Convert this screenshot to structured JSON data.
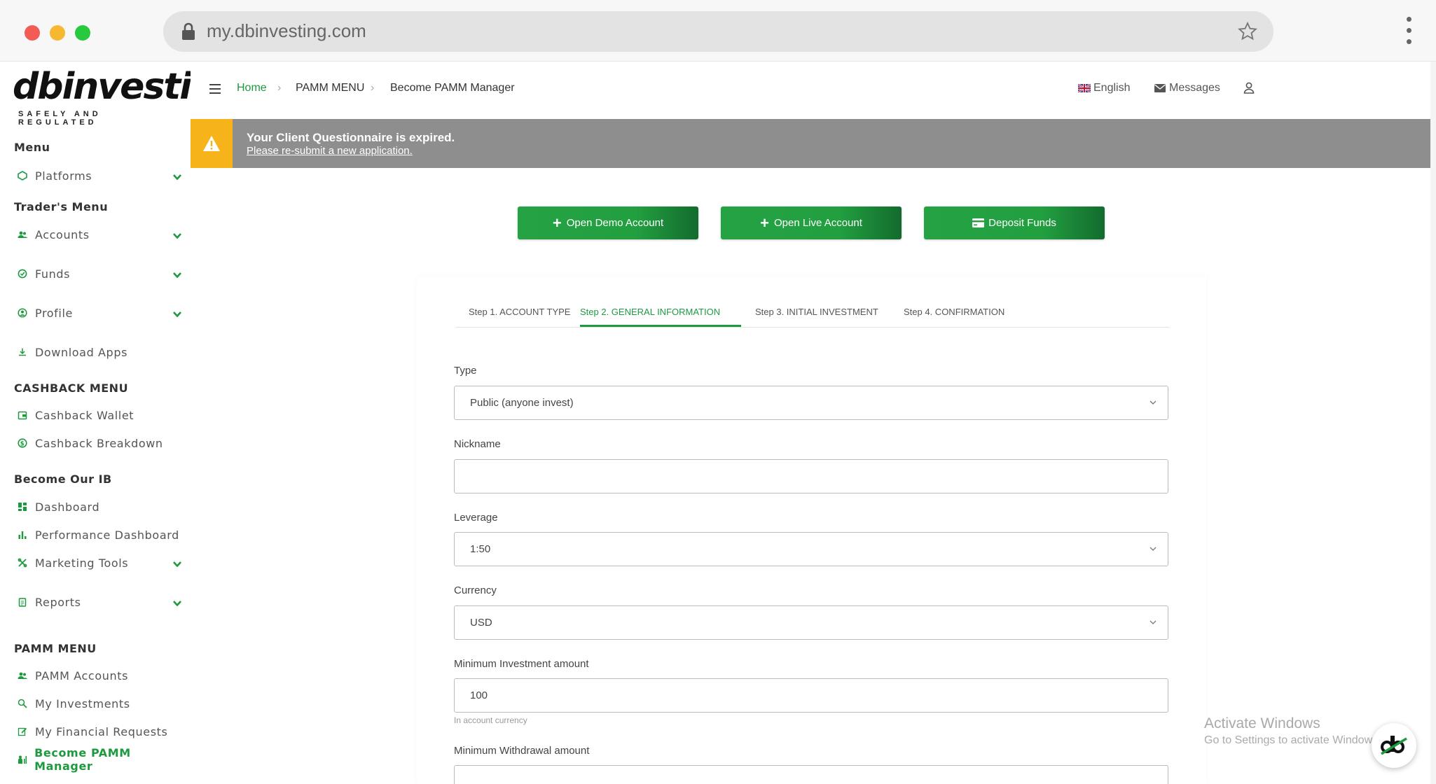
{
  "browser": {
    "url": "my.dbinvesting.com"
  },
  "brand": {
    "logo_text": "dbinvesting",
    "tagline": "SAFELY AND REGULATED",
    "accent_color": "#1d9a3f"
  },
  "sidebar": {
    "sections": {
      "menu": "Menu",
      "traders_menu": "Trader's Menu",
      "cashback_menu": "CASHBACK MENU",
      "become_ib": "Become Our IB",
      "pamm_menu": "PAMM MENU"
    },
    "items": {
      "platforms": "Platforms",
      "accounts": "Accounts",
      "funds": "Funds",
      "profile": "Profile",
      "download_apps": "Download Apps",
      "cashback_wallet": "Cashback Wallet",
      "cashback_breakdown": "Cashback Breakdown",
      "dashboard": "Dashboard",
      "performance_dashboard": "Performance Dashboard",
      "marketing_tools": "Marketing Tools",
      "reports": "Reports",
      "pamm_accounts": "PAMM Accounts",
      "my_investments": "My Investments",
      "my_financial_requests": "My Financial Requests",
      "become_pamm_manager": "Become PAMM Manager"
    }
  },
  "topnav": {
    "breadcrumb": {
      "home": "Home",
      "sep": "›",
      "pamm_menu": "PAMM MENU",
      "current": "Become PAMM Manager"
    },
    "language": "English",
    "messages": "Messages"
  },
  "alert": {
    "title": "Your Client Questionnaire is expired.",
    "link": "Please re-submit a new application."
  },
  "actions": {
    "open_demo": "Open Demo Account",
    "open_live": "Open Live Account",
    "deposit": "Deposit Funds"
  },
  "steps": {
    "s1": "Step 1. ACCOUNT TYPE",
    "s2": "Step 2. GENERAL INFORMATION",
    "s3": "Step 3. INITIAL INVESTMENT",
    "s4": "Step 4. CONFIRMATION",
    "active": 2
  },
  "form": {
    "type_label": "Type",
    "type_value": "Public (anyone invest)",
    "nickname_label": "Nickname",
    "nickname_value": "",
    "leverage_label": "Leverage",
    "leverage_value": "1:50",
    "currency_label": "Currency",
    "currency_value": "USD",
    "min_investment_label": "Minimum Investment amount",
    "min_investment_value": "100",
    "min_investment_hint": "In account currency",
    "min_withdrawal_label": "Minimum Withdrawal amount",
    "min_withdrawal_value": ""
  },
  "watermark": {
    "line1": "Activate Windows",
    "line2": "Go to Settings to activate Windows."
  }
}
